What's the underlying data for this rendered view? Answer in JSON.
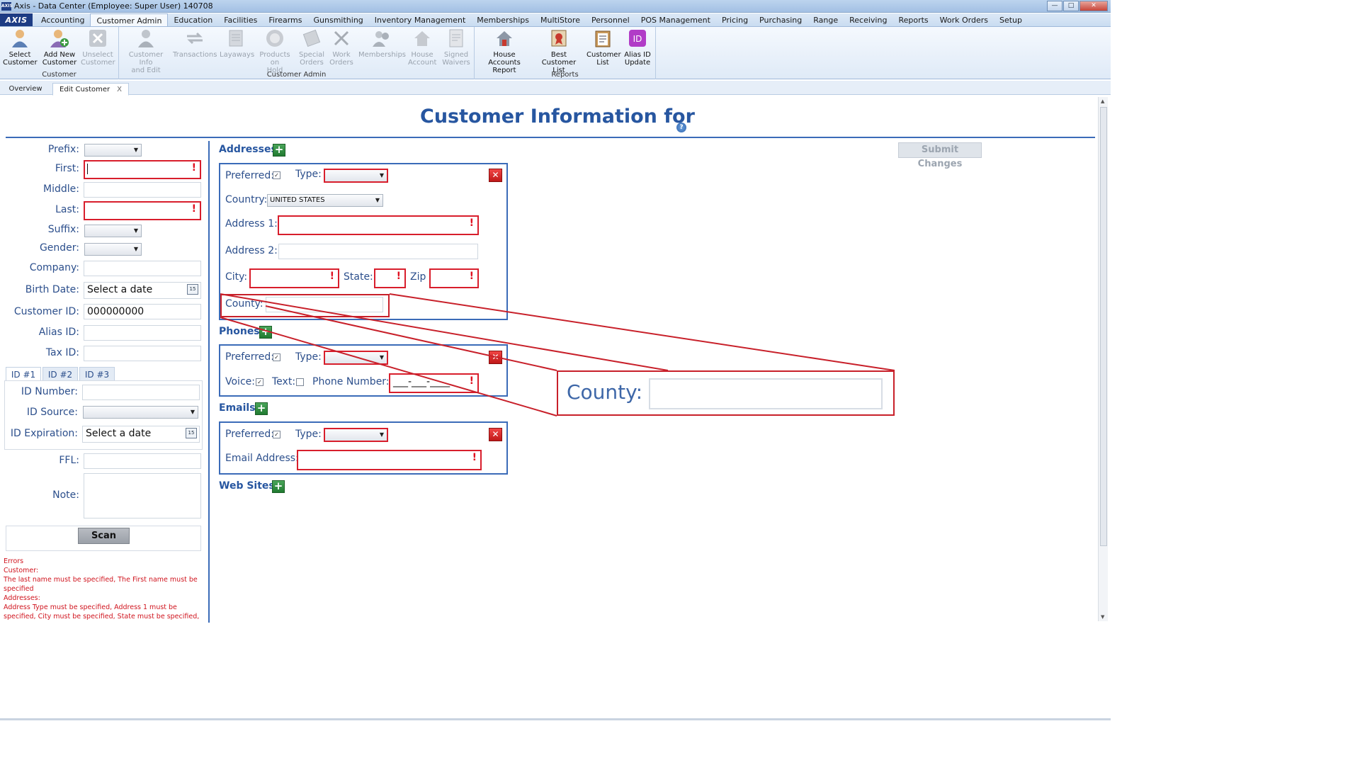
{
  "window": {
    "title": "Axis - Data Center  (Employee: Super User) 140708",
    "app_icon": "AXIS"
  },
  "menu": {
    "logo": "AXIS",
    "tabs": [
      "Accounting",
      "Customer Admin",
      "Education",
      "Facilities",
      "Firearms",
      "Gunsmithing",
      "Inventory Management",
      "Memberships",
      "MultiStore",
      "Personnel",
      "POS Management",
      "Pricing",
      "Purchasing",
      "Range",
      "Receiving",
      "Reports",
      "Work Orders",
      "Setup"
    ],
    "active": "Customer Admin"
  },
  "ribbon": {
    "groups": [
      {
        "label": "Customer",
        "buttons": [
          {
            "line1": "Select",
            "line2": "Customer",
            "icon": "person-icon",
            "disabled": false
          },
          {
            "line1": "Add New",
            "line2": "Customer",
            "icon": "add-person-icon",
            "disabled": false
          },
          {
            "line1": "Unselect",
            "line2": "Customer",
            "icon": "unselect-icon",
            "disabled": true
          }
        ]
      },
      {
        "label": "Customer Admin",
        "buttons": [
          {
            "line1": "Customer Info",
            "line2": "and Edit",
            "icon": "person-edit-icon",
            "disabled": true
          },
          {
            "line1": "Transactions",
            "line2": "",
            "icon": "arrows-icon",
            "disabled": true
          },
          {
            "line1": "Layaways",
            "line2": "",
            "icon": "layaway-icon",
            "disabled": true
          },
          {
            "line1": "Products on",
            "line2": "Hold",
            "icon": "hold-icon",
            "disabled": true
          },
          {
            "line1": "Special",
            "line2": "Orders",
            "icon": "special-order-icon",
            "disabled": true
          },
          {
            "line1": "Work",
            "line2": "Orders",
            "icon": "tools-icon",
            "disabled": true
          },
          {
            "line1": "Memberships",
            "line2": "",
            "icon": "memberships-icon",
            "disabled": true
          },
          {
            "line1": "House",
            "line2": "Account",
            "icon": "house-icon",
            "disabled": true
          },
          {
            "line1": "Signed",
            "line2": "Waivers",
            "icon": "waiver-icon",
            "disabled": true
          }
        ]
      },
      {
        "label": "Reports",
        "buttons": [
          {
            "line1": "House Accounts",
            "line2": "Report",
            "icon": "house-report-icon",
            "disabled": false
          },
          {
            "line1": "Best Customer",
            "line2": "List",
            "icon": "best-customer-icon",
            "disabled": false
          },
          {
            "line1": "Customer",
            "line2": "List",
            "icon": "clipboard-icon",
            "disabled": false
          },
          {
            "line1": "Alias ID",
            "line2": "Update",
            "icon": "id-icon",
            "disabled": false
          }
        ]
      }
    ]
  },
  "doctabs": {
    "overview": "Overview",
    "edit": "Edit Customer",
    "close": "X"
  },
  "page": {
    "title": "Customer Information for",
    "help": "?",
    "submit": "Submit Changes"
  },
  "customer": {
    "prefix_label": "Prefix:",
    "first_label": "First:",
    "middle_label": "Middle:",
    "last_label": "Last:",
    "suffix_label": "Suffix:",
    "gender_label": "Gender:",
    "company_label": "Company:",
    "birth_label": "Birth Date:",
    "birth_placeholder": "Select a date",
    "custid_label": "Customer ID:",
    "custid_value": "000000000",
    "alias_label": "Alias ID:",
    "tax_label": "Tax ID:",
    "id_tabs": [
      "ID #1",
      "ID #2",
      "ID #3"
    ],
    "idnum_label": "ID Number:",
    "idsrc_label": "ID Source:",
    "idexp_label": "ID Expiration:",
    "idexp_placeholder": "Select a date",
    "ffl_label": "FFL:",
    "note_label": "Note:",
    "scan": "Scan",
    "cal_glyph": "15",
    "error_mark": "!"
  },
  "errors": {
    "lines": [
      "Errors",
      "Customer:",
      "The last name must be specified, The First name must be",
      "specified",
      "Addresses:",
      "Address Type must be specified, Address 1 must be",
      "specified, City must be specified, State must be specified,"
    ]
  },
  "addresses": {
    "heading": "Addresses",
    "preferred": "Preferred:",
    "type": "Type:",
    "country_label": "Country:",
    "country_value": "UNITED STATES",
    "addr1": "Address 1:",
    "addr2": "Address 2:",
    "city": "City:",
    "state": "State:",
    "zip": "Zip",
    "county": "County:"
  },
  "phones": {
    "heading": "Phones",
    "preferred": "Preferred:",
    "type": "Type:",
    "voice": "Voice:",
    "text": "Text:",
    "phone_label": "Phone Number:",
    "phone_mask": "___-___-____"
  },
  "emails": {
    "heading": "Emails",
    "preferred": "Preferred:",
    "type": "Type:",
    "email_label": "Email Address:"
  },
  "websites": {
    "heading": "Web Sites"
  },
  "zoom": {
    "label": "County:"
  },
  "colors": {
    "accent": "#2756a0",
    "error": "#d81e2c",
    "callout": "#c8202a"
  }
}
